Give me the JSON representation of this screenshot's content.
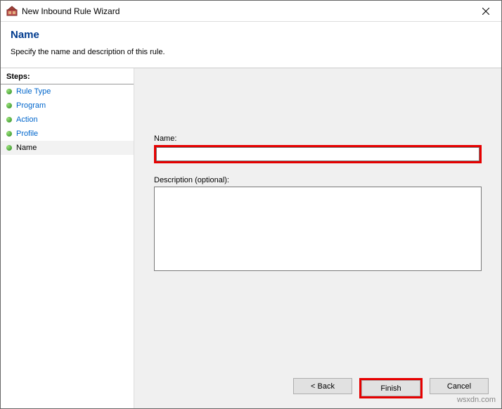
{
  "window": {
    "title": "New Inbound Rule Wizard"
  },
  "header": {
    "title": "Name",
    "subtitle": "Specify the name and description of this rule."
  },
  "sidebar": {
    "heading": "Steps:",
    "items": [
      {
        "label": "Rule Type",
        "state": "done"
      },
      {
        "label": "Program",
        "state": "done"
      },
      {
        "label": "Action",
        "state": "done"
      },
      {
        "label": "Profile",
        "state": "done"
      },
      {
        "label": "Name",
        "state": "current"
      }
    ]
  },
  "form": {
    "name_label": "Name:",
    "name_value": "",
    "desc_label": "Description (optional):",
    "desc_value": ""
  },
  "buttons": {
    "back": "< Back",
    "finish": "Finish",
    "cancel": "Cancel"
  },
  "highlight": {
    "color": "#e60000"
  },
  "watermark": "wsxdn.com"
}
